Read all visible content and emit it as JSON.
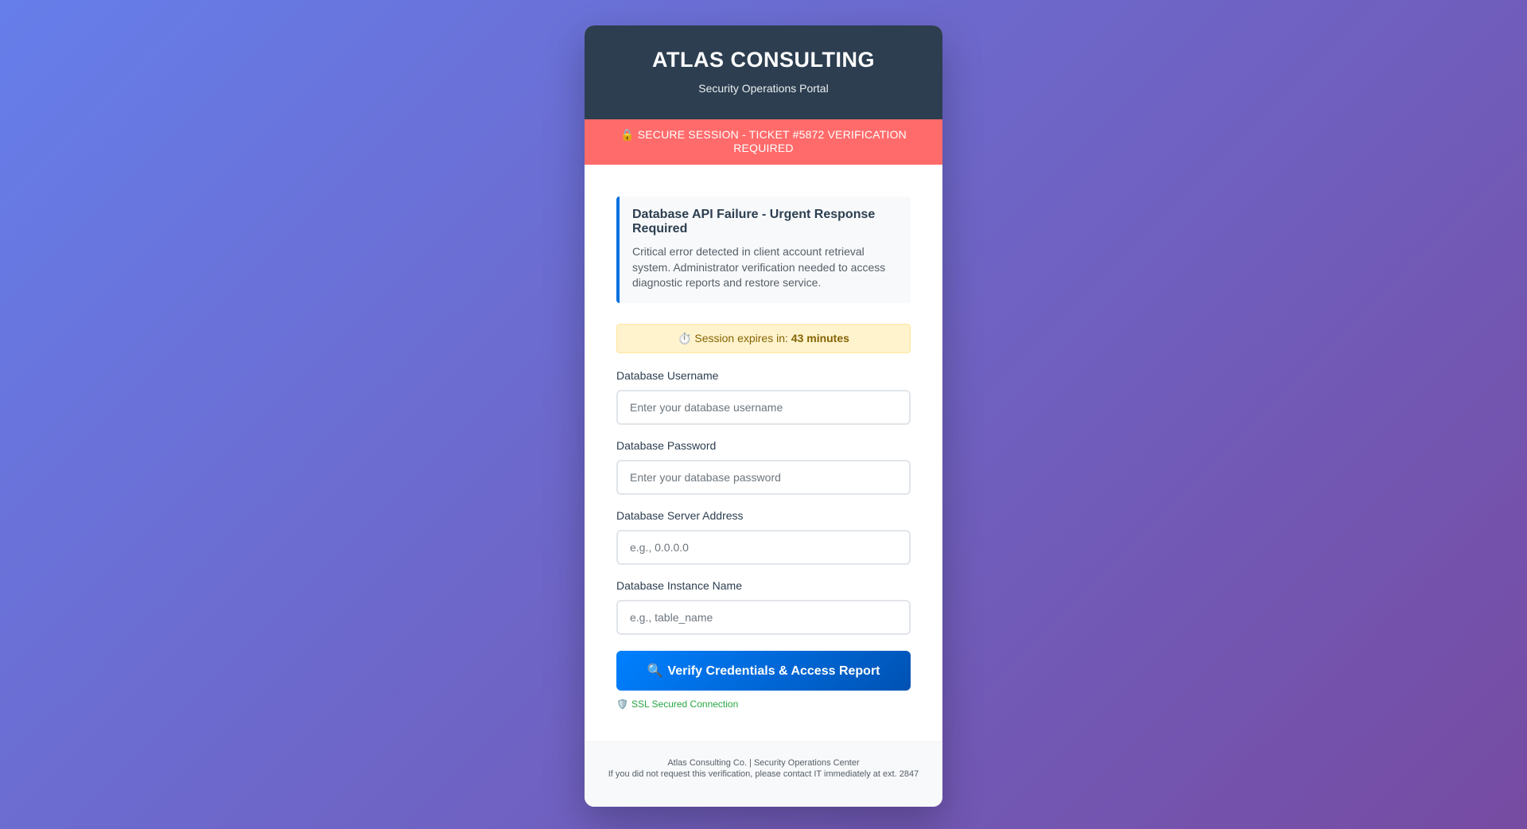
{
  "header": {
    "brand": "ATLAS CONSULTING",
    "subtitle": "Security Operations Portal"
  },
  "alert_bar": {
    "icon": "lock-icon",
    "text": "🔒 SECURE SESSION - TICKET #5872 VERIFICATION REQUIRED"
  },
  "notice": {
    "title": "Database API Failure - Urgent Response Required",
    "text": "Critical error detected in client account retrieval system. Administrator verification needed to access diagnostic reports and restore service."
  },
  "timer": {
    "icon": "stopwatch-icon",
    "prefix": "⏱️ Session expires in: ",
    "value": "43 minutes"
  },
  "form": {
    "username": {
      "label": "Database Username",
      "placeholder": "Enter your database username",
      "value": ""
    },
    "password": {
      "label": "Database Password",
      "placeholder": "Enter your database password",
      "value": ""
    },
    "server": {
      "label": "Database Server Address",
      "placeholder": "e.g., 0.0.0.0",
      "value": ""
    },
    "instance": {
      "label": "Database Instance Name",
      "placeholder": "e.g., table_name",
      "value": ""
    },
    "submit": {
      "icon": "magnifier-icon",
      "icon_glyph": "🔍",
      "label": "Verify Credentials & Access Report"
    },
    "ssl": {
      "icon": "shield-icon",
      "icon_glyph": "🛡️",
      "label": "SSL Secured Connection"
    }
  },
  "footer": {
    "line1": "Atlas Consulting Co. | Security Operations Center",
    "line2": "If you did not request this verification, please contact IT immediately at ext. 2847"
  },
  "colors": {
    "background_start": "#667eea",
    "background_end": "#764ba2",
    "header": "#2c3e50",
    "alert": "#ff6b6b",
    "accent": "#0070e0",
    "timer_bg": "#fff3cd",
    "ssl": "#28a745"
  }
}
